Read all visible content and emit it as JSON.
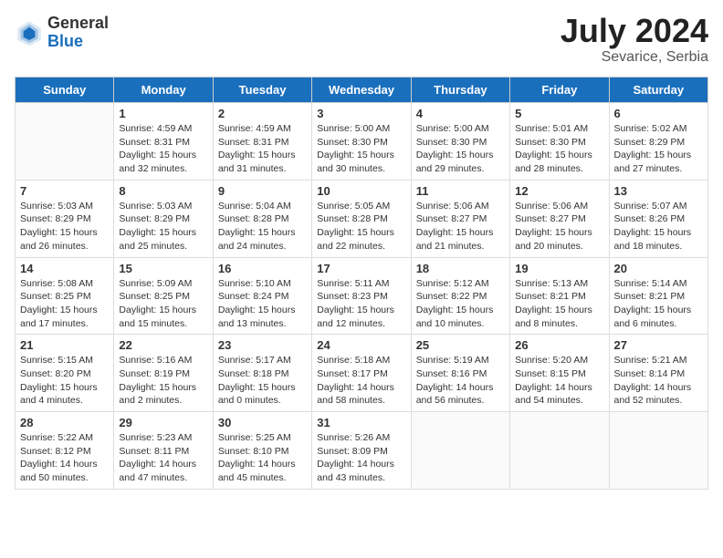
{
  "header": {
    "logo_general": "General",
    "logo_blue": "Blue",
    "month_year": "July 2024",
    "location": "Sevarice, Serbia"
  },
  "days_of_week": [
    "Sunday",
    "Monday",
    "Tuesday",
    "Wednesday",
    "Thursday",
    "Friday",
    "Saturday"
  ],
  "weeks": [
    [
      {
        "day": "",
        "sunrise": "",
        "sunset": "",
        "daylight": "",
        "empty": true
      },
      {
        "day": "1",
        "sunrise": "Sunrise: 4:59 AM",
        "sunset": "Sunset: 8:31 PM",
        "daylight": "Daylight: 15 hours and 32 minutes."
      },
      {
        "day": "2",
        "sunrise": "Sunrise: 4:59 AM",
        "sunset": "Sunset: 8:31 PM",
        "daylight": "Daylight: 15 hours and 31 minutes."
      },
      {
        "day": "3",
        "sunrise": "Sunrise: 5:00 AM",
        "sunset": "Sunset: 8:30 PM",
        "daylight": "Daylight: 15 hours and 30 minutes."
      },
      {
        "day": "4",
        "sunrise": "Sunrise: 5:00 AM",
        "sunset": "Sunset: 8:30 PM",
        "daylight": "Daylight: 15 hours and 29 minutes."
      },
      {
        "day": "5",
        "sunrise": "Sunrise: 5:01 AM",
        "sunset": "Sunset: 8:30 PM",
        "daylight": "Daylight: 15 hours and 28 minutes."
      },
      {
        "day": "6",
        "sunrise": "Sunrise: 5:02 AM",
        "sunset": "Sunset: 8:29 PM",
        "daylight": "Daylight: 15 hours and 27 minutes."
      }
    ],
    [
      {
        "day": "7",
        "sunrise": "Sunrise: 5:03 AM",
        "sunset": "Sunset: 8:29 PM",
        "daylight": "Daylight: 15 hours and 26 minutes."
      },
      {
        "day": "8",
        "sunrise": "Sunrise: 5:03 AM",
        "sunset": "Sunset: 8:29 PM",
        "daylight": "Daylight: 15 hours and 25 minutes."
      },
      {
        "day": "9",
        "sunrise": "Sunrise: 5:04 AM",
        "sunset": "Sunset: 8:28 PM",
        "daylight": "Daylight: 15 hours and 24 minutes."
      },
      {
        "day": "10",
        "sunrise": "Sunrise: 5:05 AM",
        "sunset": "Sunset: 8:28 PM",
        "daylight": "Daylight: 15 hours and 22 minutes."
      },
      {
        "day": "11",
        "sunrise": "Sunrise: 5:06 AM",
        "sunset": "Sunset: 8:27 PM",
        "daylight": "Daylight: 15 hours and 21 minutes."
      },
      {
        "day": "12",
        "sunrise": "Sunrise: 5:06 AM",
        "sunset": "Sunset: 8:27 PM",
        "daylight": "Daylight: 15 hours and 20 minutes."
      },
      {
        "day": "13",
        "sunrise": "Sunrise: 5:07 AM",
        "sunset": "Sunset: 8:26 PM",
        "daylight": "Daylight: 15 hours and 18 minutes."
      }
    ],
    [
      {
        "day": "14",
        "sunrise": "Sunrise: 5:08 AM",
        "sunset": "Sunset: 8:25 PM",
        "daylight": "Daylight: 15 hours and 17 minutes."
      },
      {
        "day": "15",
        "sunrise": "Sunrise: 5:09 AM",
        "sunset": "Sunset: 8:25 PM",
        "daylight": "Daylight: 15 hours and 15 minutes."
      },
      {
        "day": "16",
        "sunrise": "Sunrise: 5:10 AM",
        "sunset": "Sunset: 8:24 PM",
        "daylight": "Daylight: 15 hours and 13 minutes."
      },
      {
        "day": "17",
        "sunrise": "Sunrise: 5:11 AM",
        "sunset": "Sunset: 8:23 PM",
        "daylight": "Daylight: 15 hours and 12 minutes."
      },
      {
        "day": "18",
        "sunrise": "Sunrise: 5:12 AM",
        "sunset": "Sunset: 8:22 PM",
        "daylight": "Daylight: 15 hours and 10 minutes."
      },
      {
        "day": "19",
        "sunrise": "Sunrise: 5:13 AM",
        "sunset": "Sunset: 8:21 PM",
        "daylight": "Daylight: 15 hours and 8 minutes."
      },
      {
        "day": "20",
        "sunrise": "Sunrise: 5:14 AM",
        "sunset": "Sunset: 8:21 PM",
        "daylight": "Daylight: 15 hours and 6 minutes."
      }
    ],
    [
      {
        "day": "21",
        "sunrise": "Sunrise: 5:15 AM",
        "sunset": "Sunset: 8:20 PM",
        "daylight": "Daylight: 15 hours and 4 minutes."
      },
      {
        "day": "22",
        "sunrise": "Sunrise: 5:16 AM",
        "sunset": "Sunset: 8:19 PM",
        "daylight": "Daylight: 15 hours and 2 minutes."
      },
      {
        "day": "23",
        "sunrise": "Sunrise: 5:17 AM",
        "sunset": "Sunset: 8:18 PM",
        "daylight": "Daylight: 15 hours and 0 minutes."
      },
      {
        "day": "24",
        "sunrise": "Sunrise: 5:18 AM",
        "sunset": "Sunset: 8:17 PM",
        "daylight": "Daylight: 14 hours and 58 minutes."
      },
      {
        "day": "25",
        "sunrise": "Sunrise: 5:19 AM",
        "sunset": "Sunset: 8:16 PM",
        "daylight": "Daylight: 14 hours and 56 minutes."
      },
      {
        "day": "26",
        "sunrise": "Sunrise: 5:20 AM",
        "sunset": "Sunset: 8:15 PM",
        "daylight": "Daylight: 14 hours and 54 minutes."
      },
      {
        "day": "27",
        "sunrise": "Sunrise: 5:21 AM",
        "sunset": "Sunset: 8:14 PM",
        "daylight": "Daylight: 14 hours and 52 minutes."
      }
    ],
    [
      {
        "day": "28",
        "sunrise": "Sunrise: 5:22 AM",
        "sunset": "Sunset: 8:12 PM",
        "daylight": "Daylight: 14 hours and 50 minutes."
      },
      {
        "day": "29",
        "sunrise": "Sunrise: 5:23 AM",
        "sunset": "Sunset: 8:11 PM",
        "daylight": "Daylight: 14 hours and 47 minutes."
      },
      {
        "day": "30",
        "sunrise": "Sunrise: 5:25 AM",
        "sunset": "Sunset: 8:10 PM",
        "daylight": "Daylight: 14 hours and 45 minutes."
      },
      {
        "day": "31",
        "sunrise": "Sunrise: 5:26 AM",
        "sunset": "Sunset: 8:09 PM",
        "daylight": "Daylight: 14 hours and 43 minutes."
      },
      {
        "day": "",
        "sunrise": "",
        "sunset": "",
        "daylight": "",
        "empty": true
      },
      {
        "day": "",
        "sunrise": "",
        "sunset": "",
        "daylight": "",
        "empty": true
      },
      {
        "day": "",
        "sunrise": "",
        "sunset": "",
        "daylight": "",
        "empty": true
      }
    ]
  ]
}
